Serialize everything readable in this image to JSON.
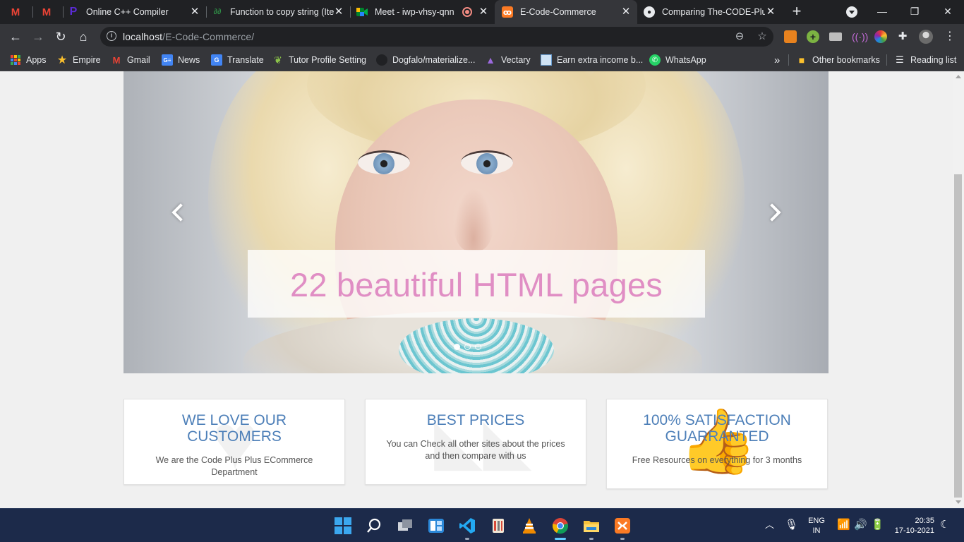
{
  "browser": {
    "tabs": [
      {
        "title": "",
        "icon": "gmail-icon"
      },
      {
        "title": "",
        "icon": "gmail-icon"
      },
      {
        "title": "Online C++ Compiler",
        "icon": "programiz-icon"
      },
      {
        "title": "Function to copy string (Ite",
        "icon": "geeksforgeeks-icon"
      },
      {
        "title": "Meet - iwp-vhsy-qnn",
        "icon": "google-meet-icon"
      },
      {
        "title": "E-Code-Commerce",
        "icon": "xampp-icon",
        "active": true
      },
      {
        "title": "Comparing The-CODE-Plu",
        "icon": "github-icon"
      }
    ],
    "address": {
      "host": "localhost",
      "path": "/E-Code-Commerce/"
    },
    "bookmarks": [
      {
        "label": "Apps",
        "icon": "apps-grid-icon"
      },
      {
        "label": "Empire",
        "icon": "star-icon"
      },
      {
        "label": "Gmail",
        "icon": "gmail-icon"
      },
      {
        "label": "News",
        "icon": "google-news-icon"
      },
      {
        "label": "Translate",
        "icon": "google-translate-icon"
      },
      {
        "label": "Tutor Profile Setting",
        "icon": "leaf-icon"
      },
      {
        "label": "Dogfalo/materialize...",
        "icon": "github-icon"
      },
      {
        "label": "Vectary",
        "icon": "vectary-icon"
      },
      {
        "label": "Earn extra income b...",
        "icon": "image-icon"
      },
      {
        "label": "WhatsApp",
        "icon": "whatsapp-icon"
      }
    ],
    "bookmarks_overflow": "»",
    "other_bookmarks": "Other bookmarks",
    "reading_list": "Reading list"
  },
  "page": {
    "carousel": {
      "caption": "22 beautiful HTML pages",
      "slide_count": 3,
      "active_slide": 1
    },
    "features": [
      {
        "title": "WE LOVE OUR CUSTOMERS",
        "text": "We are the Code Plus Plus ECommerce Department",
        "icon": "heart-icon"
      },
      {
        "title": "BEST PRICES",
        "text": "You can Check all other sites about the prices and then compare with us",
        "icon": "tags-icon"
      },
      {
        "title": "100% SATISFACTION GUARRANTED",
        "text": "Free Resources on everything for 3 months",
        "icon": "thumbs-up-icon"
      }
    ]
  },
  "taskbar": {
    "language": "ENG",
    "region": "IN",
    "time": "20:35",
    "date": "17-10-2021"
  },
  "colors": {
    "caption_text": "#e08ec4",
    "feature_title": "#4d7fb8",
    "taskbar": "#1c2a4a",
    "active_tab": "#35363a"
  }
}
